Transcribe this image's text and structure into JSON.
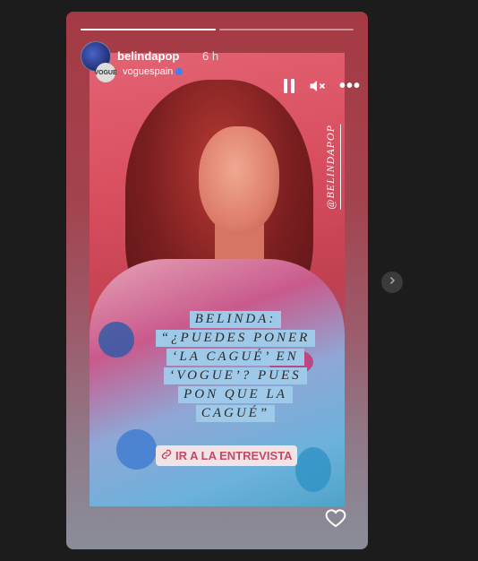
{
  "story": {
    "progress": [
      1.0,
      0.0
    ],
    "username": "belindapop",
    "time": "6 h",
    "shared_from": {
      "avatar_text": "VOGUE",
      "username": "voguespain",
      "verified": true
    }
  },
  "controls": {
    "pause_icon": "pause-icon",
    "mute_icon": "mute-icon",
    "more_icon": "more-icon"
  },
  "content": {
    "watermark": "@BELINDAPOP",
    "quote_lines": [
      "BELINDA:",
      "“¿PUEDES PONER",
      "‘LA CAGUÉ’ EN",
      "‘VOGUE’? PUES",
      "PON QUE LA",
      "CAGUÉ”"
    ],
    "link_label": "IR A LA ENTREVISTA"
  },
  "footer": {
    "like_icon": "heart-icon"
  },
  "nav": {
    "next_icon": "chevron-right-icon"
  },
  "colors": {
    "link": "#c24a66",
    "quote_bg": "#9ec9e8",
    "page_bg": "#1c1c1c"
  }
}
